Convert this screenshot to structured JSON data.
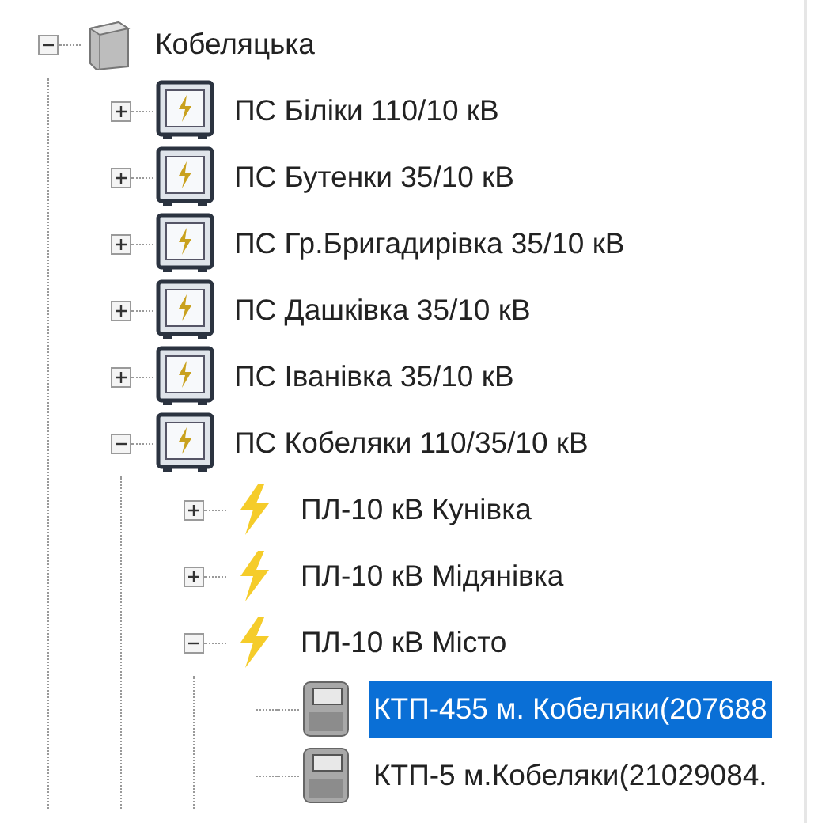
{
  "tree": [
    {
      "label": "Кобеляцька",
      "kind": "server",
      "expanded": true,
      "children": [
        {
          "label": "ПС Біліки 110/10 кВ",
          "kind": "substation",
          "expanded": false
        },
        {
          "label": "ПС Бутенки 35/10 кВ",
          "kind": "substation",
          "expanded": false
        },
        {
          "label": "ПС Гр.Бригадирівка 35/10 кВ",
          "kind": "substation",
          "expanded": false
        },
        {
          "label": "ПС Дашківка 35/10 кВ",
          "kind": "substation",
          "expanded": false
        },
        {
          "label": "ПС Іванівка 35/10 кВ",
          "kind": "substation",
          "expanded": false
        },
        {
          "label": "ПС Кобеляки 110/35/10 кВ",
          "kind": "substation",
          "expanded": true,
          "children": [
            {
              "label": "ПЛ-10 кВ Кунівка",
              "kind": "line",
              "expanded": false
            },
            {
              "label": "ПЛ-10 кВ Мідянівка",
              "kind": "line",
              "expanded": false
            },
            {
              "label": "ПЛ-10 кВ Місто",
              "kind": "line",
              "expanded": true,
              "children": [
                {
                  "label": "КТП-455 м. Кобеляки(207688",
                  "kind": "meter",
                  "selected": true
                },
                {
                  "label": "КТП-5 м.Кобеляки(21029084.",
                  "kind": "meter",
                  "selected": false
                }
              ]
            }
          ]
        }
      ]
    }
  ]
}
